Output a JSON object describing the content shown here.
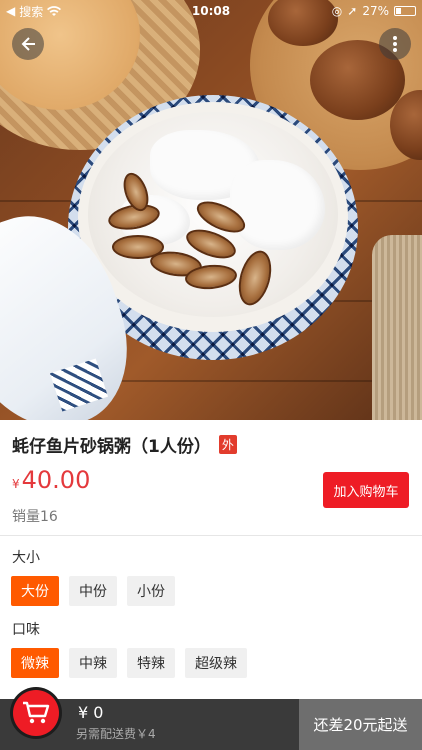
{
  "status_bar": {
    "carrier": "搜索",
    "time": "10:08",
    "battery": "27%"
  },
  "icons": {
    "back": "back-arrow-icon",
    "more": "more-vertical-icon",
    "cart": "shopping-cart-icon",
    "wifi": "wifi-icon",
    "location": "location-icon",
    "battery": "battery-icon"
  },
  "product": {
    "name": "蚝仔鱼片砂锅粥（1人份）",
    "tag": "外",
    "currency": "¥",
    "price": "40.00",
    "add_to_cart": "加入购物车",
    "sales": "销量16"
  },
  "options": {
    "size": {
      "label": "大小",
      "items": [
        "大份",
        "中份",
        "小份"
      ],
      "selected": "大份"
    },
    "taste": {
      "label": "口味",
      "items": [
        "微辣",
        "中辣",
        "特辣",
        "超级辣"
      ],
      "selected": "微辣"
    }
  },
  "bottom_bar": {
    "total": "¥ 0",
    "delivery_fee": "另需配送费￥4",
    "checkout": "还差20元起送"
  },
  "colors": {
    "accent_red": "#ee1c25",
    "price_red": "#e4393c",
    "selected_orange": "#ff5a00",
    "bottom_bar": "#3a3a3a",
    "checkout_disabled": "#6e6e6e"
  }
}
